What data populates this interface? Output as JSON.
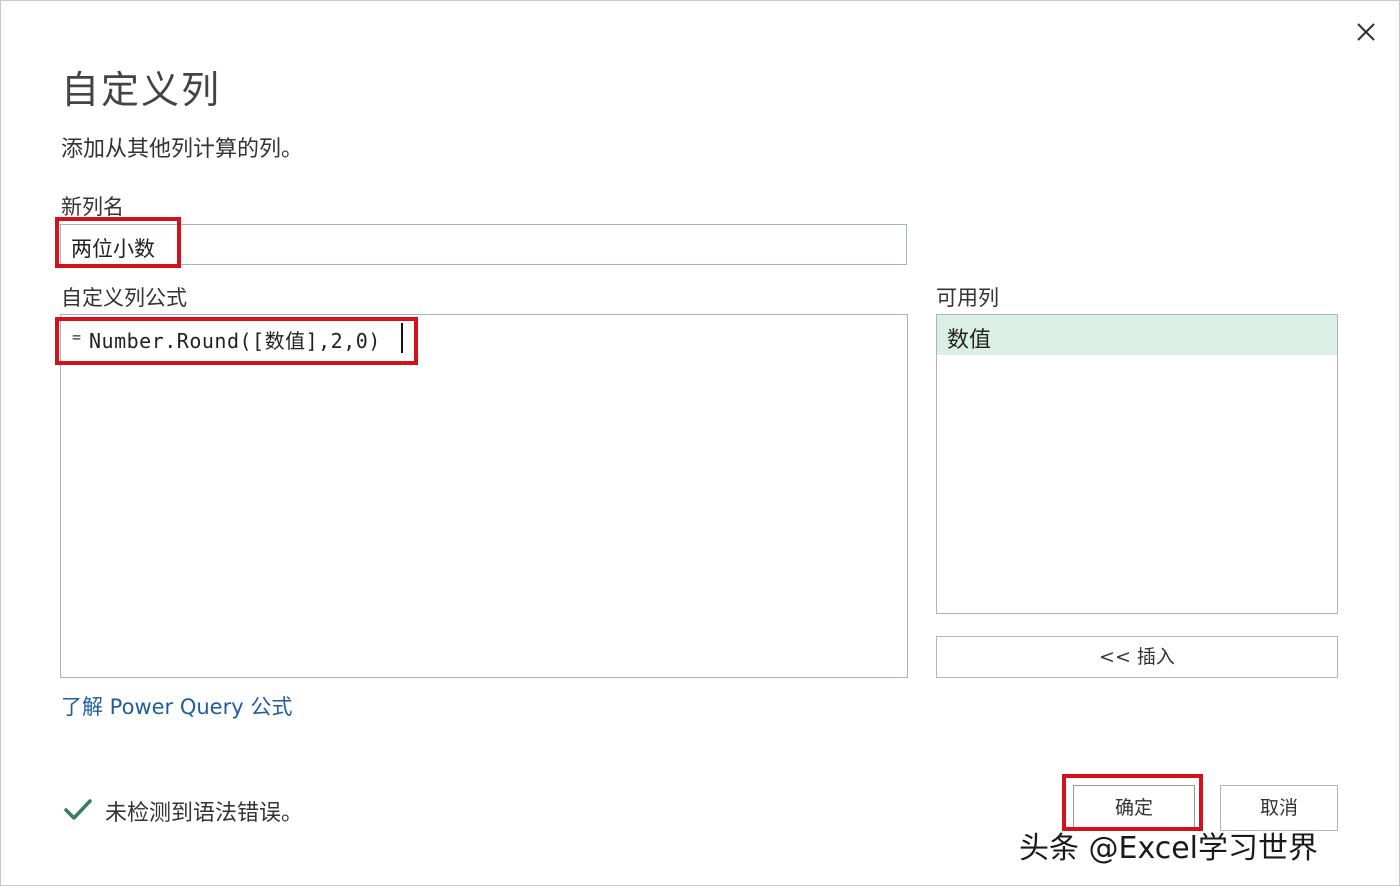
{
  "dialog": {
    "title": "自定义列",
    "subtitle": "添加从其他列计算的列。"
  },
  "new_column": {
    "label": "新列名",
    "value": "两位小数"
  },
  "formula": {
    "label": "自定义列公式",
    "equals": "=",
    "value": "Number.Round([数值],2,0)"
  },
  "available_columns": {
    "label": "可用列",
    "items": [
      "数值"
    ]
  },
  "buttons": {
    "insert": "<< 插入",
    "ok": "确定",
    "cancel": "取消"
  },
  "learn_link": "了解 Power Query 公式",
  "status": {
    "text": "未检测到语法错误。",
    "icon": "check-icon",
    "icon_color": "#3a7d5c"
  },
  "highlight_color": "#d4121c",
  "watermark": "头条 @Excel学习世界"
}
